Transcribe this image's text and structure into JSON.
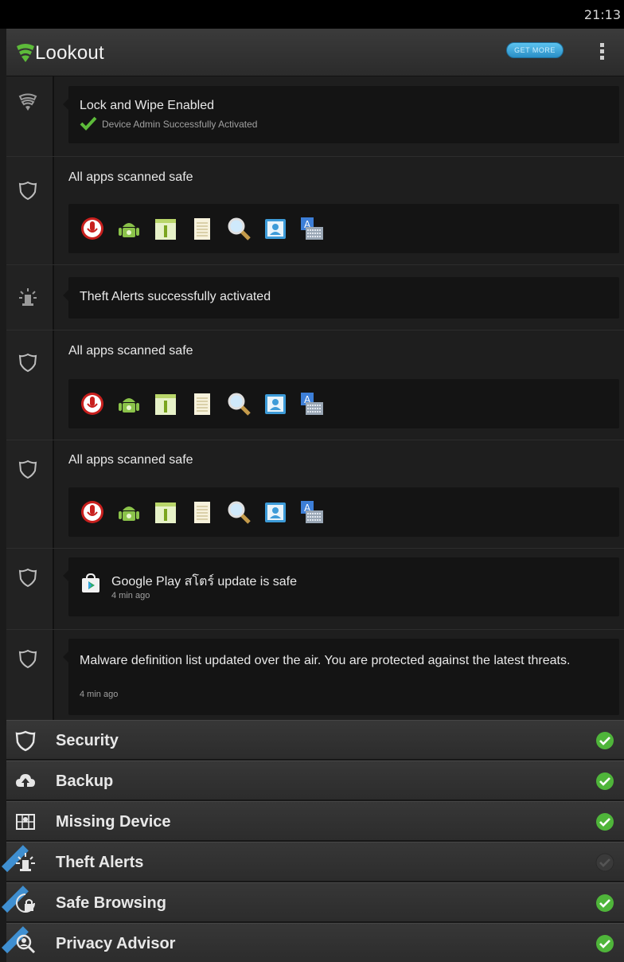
{
  "status_bar": {
    "time": "21:13"
  },
  "app_bar": {
    "title": "Lookout",
    "get_more_label": "GET MORE",
    "logo_icon": "lookout-shield-icon",
    "menu_icon": "overflow-menu-icon",
    "accent_color": "#5dbb3a"
  },
  "timeline": {
    "lock_wipe": {
      "title": "Lock and Wipe Enabled",
      "subtitle": "Device Admin Successfully Activated",
      "icon": "lookout-shield-icon"
    },
    "scan_1": {
      "title": "All apps scanned safe",
      "icon": "shield-icon"
    },
    "theft_alert": {
      "title": "Theft Alerts successfully activated",
      "icon": "siren-icon"
    },
    "scan_2": {
      "title": "All apps scanned safe",
      "icon": "shield-icon"
    },
    "scan_3": {
      "title": "All apps scanned safe",
      "icon": "shield-icon"
    },
    "play_update": {
      "title": "Google Play สโตร์ update is safe",
      "time": "4 min ago",
      "icon": "shield-icon"
    },
    "malware": {
      "title": "Malware definition list updated over the air. You are protected against the latest threats.",
      "time": "4 min ago",
      "icon": "shield-icon"
    },
    "scanned_app_icons": [
      "voice-recorder-icon",
      "android-robot-icon",
      "calendar-one-icon",
      "notepad-icon",
      "magnifier-icon",
      "contacts-icon",
      "keyboard-icon"
    ]
  },
  "nav": {
    "items": [
      {
        "label": "Security",
        "icon": "shield-icon",
        "status": "ok"
      },
      {
        "label": "Backup",
        "icon": "cloud-upload-icon",
        "status": "ok"
      },
      {
        "label": "Missing Device",
        "icon": "map-icon",
        "status": "ok"
      },
      {
        "label": "Theft Alerts",
        "icon": "siren-icon",
        "status": "off"
      },
      {
        "label": "Safe Browsing",
        "icon": "browser-lock-icon",
        "status": "ok"
      },
      {
        "label": "Privacy Advisor",
        "icon": "magnifier-person-icon",
        "status": "ok"
      }
    ],
    "ok_color": "#4fb53a",
    "off_color": "#3a3a3a"
  }
}
